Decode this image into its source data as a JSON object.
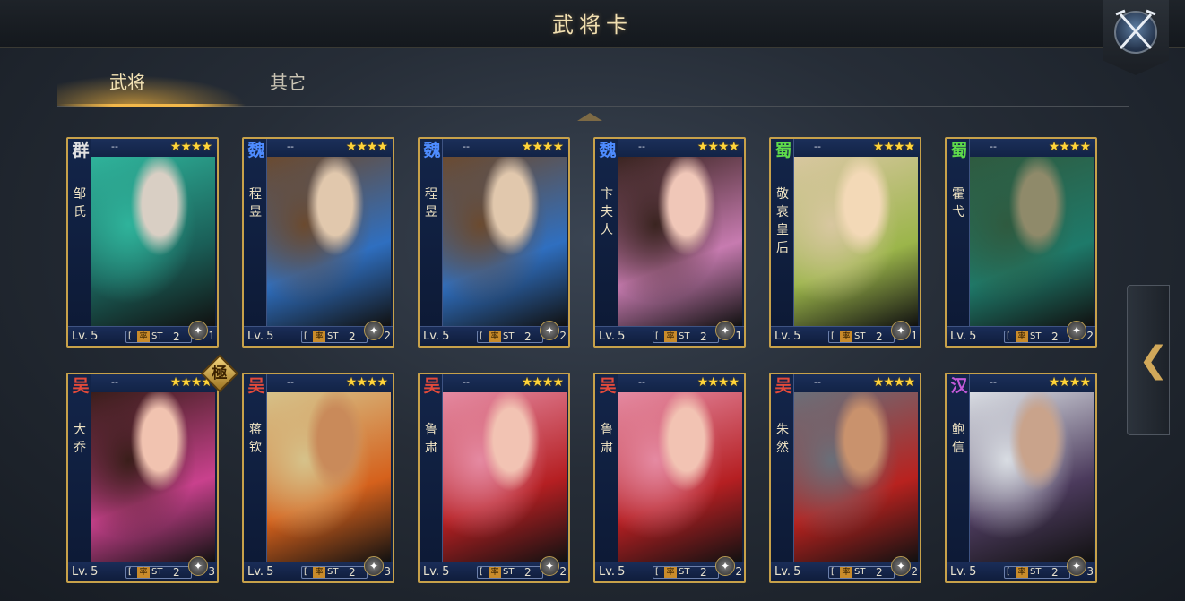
{
  "header": {
    "title": "武将卡",
    "close_icon": "crossed-swords-icon"
  },
  "tabs": [
    {
      "label": "武将",
      "active": true
    },
    {
      "label": "其它",
      "active": false
    }
  ],
  "colors": {
    "accent_gold": "#c7a14a",
    "faction_qun": "#e0e0e0",
    "faction_wei": "#4e8cff",
    "faction_shu": "#5fdc4a",
    "faction_wu": "#e24a3b",
    "faction_han": "#c35ad9"
  },
  "cards": [
    {
      "faction": "群",
      "faction_color": "#e0e0e0",
      "rank": "--",
      "stars": "★★★★",
      "name": "邹氏",
      "level_prefix": "Lv.",
      "level": "5",
      "stat_label": "率",
      "stat_code": "ST",
      "stat_value": "2",
      "type_count": "1",
      "portrait": [
        "#2fb39b",
        "#d9cfc4",
        "#1a5e57"
      ]
    },
    {
      "faction": "魏",
      "faction_color": "#4e8cff",
      "rank": "--",
      "stars": "★★★★",
      "name": "程昱",
      "level_prefix": "Lv.",
      "level": "5",
      "stat_label": "率",
      "stat_code": "ST",
      "stat_value": "2",
      "type_count": "2",
      "portrait": [
        "#6b4a2f",
        "#e1c8ad",
        "#2f6fc0"
      ]
    },
    {
      "faction": "魏",
      "faction_color": "#4e8cff",
      "rank": "--",
      "stars": "★★★★",
      "name": "程昱",
      "level_prefix": "Lv.",
      "level": "5",
      "stat_label": "率",
      "stat_code": "ST",
      "stat_value": "2",
      "type_count": "2",
      "portrait": [
        "#6b4a2f",
        "#e1c8ad",
        "#2f6fc0"
      ]
    },
    {
      "faction": "魏",
      "faction_color": "#4e8cff",
      "rank": "--",
      "stars": "★★★★",
      "name": "卞夫人",
      "level_prefix": "Lv.",
      "level": "5",
      "stat_label": "率",
      "stat_code": "ST",
      "stat_value": "2",
      "type_count": "1",
      "portrait": [
        "#3a2420",
        "#f0c7b8",
        "#c77bb0"
      ]
    },
    {
      "faction": "蜀",
      "faction_color": "#5fdc4a",
      "rank": "--",
      "stars": "★★★★",
      "name": "敬哀皇后",
      "level_prefix": "Lv.",
      "level": "5",
      "stat_label": "率",
      "stat_code": "ST",
      "stat_value": "2",
      "type_count": "1",
      "portrait": [
        "#d8c7a0",
        "#f3d9b7",
        "#9bb54a"
      ]
    },
    {
      "faction": "蜀",
      "faction_color": "#5fdc4a",
      "rank": "--",
      "stars": "★★★★",
      "name": "霍弋",
      "level_prefix": "Lv.",
      "level": "5",
      "stat_label": "率",
      "stat_code": "ST",
      "stat_value": "2",
      "type_count": "2",
      "portrait": [
        "#2f5a3f",
        "#8f8a6a",
        "#1e7a6a"
      ]
    },
    {
      "faction": "吴",
      "faction_color": "#e24a3b",
      "rank": "--",
      "stars": "★★★★",
      "name": "大乔",
      "level_prefix": "Lv.",
      "level": "5",
      "stat_label": "率",
      "stat_code": "ST",
      "stat_value": "2",
      "type_count": "3",
      "portrait": [
        "#3a1e1a",
        "#f1c3b0",
        "#c9418d"
      ],
      "badge": "極"
    },
    {
      "faction": "吴",
      "faction_color": "#e24a3b",
      "rank": "--",
      "stars": "★★★★",
      "name": "蒋钦",
      "level_prefix": "Lv.",
      "level": "5",
      "stat_label": "率",
      "stat_code": "ST",
      "stat_value": "2",
      "type_count": "3",
      "portrait": [
        "#d6c28a",
        "#c98a5a",
        "#d5611c"
      ]
    },
    {
      "faction": "吴",
      "faction_color": "#e24a3b",
      "rank": "--",
      "stars": "★★★★",
      "name": "鲁肃",
      "level_prefix": "Lv.",
      "level": "5",
      "stat_label": "率",
      "stat_code": "ST",
      "stat_value": "2",
      "type_count": "2",
      "portrait": [
        "#e58aa2",
        "#f2c3b3",
        "#b51f22"
      ]
    },
    {
      "faction": "吴",
      "faction_color": "#e24a3b",
      "rank": "--",
      "stars": "★★★★",
      "name": "鲁肃",
      "level_prefix": "Lv.",
      "level": "5",
      "stat_label": "率",
      "stat_code": "ST",
      "stat_value": "2",
      "type_count": "2",
      "portrait": [
        "#e58aa2",
        "#f2c3b3",
        "#b51f22"
      ]
    },
    {
      "faction": "吴",
      "faction_color": "#e24a3b",
      "rank": "--",
      "stars": "★★★★",
      "name": "朱然",
      "level_prefix": "Lv.",
      "level": "5",
      "stat_label": "率",
      "stat_code": "ST",
      "stat_value": "2",
      "type_count": "2",
      "portrait": [
        "#6a6f79",
        "#c9926d",
        "#b8221f"
      ]
    },
    {
      "faction": "汉",
      "faction_color": "#c35ad9",
      "rank": "--",
      "stars": "★★★★",
      "name": "鲍信",
      "level_prefix": "Lv.",
      "level": "5",
      "stat_label": "率",
      "stat_code": "ST",
      "stat_value": "2",
      "type_count": "3",
      "portrait": [
        "#d9dde3",
        "#c9a38b",
        "#4b3a5c"
      ]
    }
  ],
  "side_tab": {
    "arrow": "❮",
    "icon": "chevron-left-icon"
  }
}
